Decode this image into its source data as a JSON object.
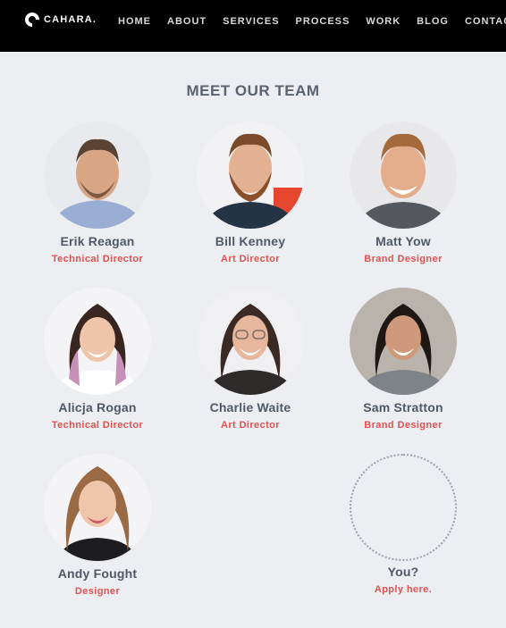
{
  "brand": {
    "name": "CAHARA."
  },
  "nav": {
    "items": [
      "HOME",
      "ABOUT",
      "SERVICES",
      "PROCESS",
      "WORK",
      "BLOG",
      "CONTACT"
    ]
  },
  "section": {
    "title": "MEET OUR TEAM"
  },
  "team": [
    {
      "name": "Erik Reagan",
      "role": "Technical Director"
    },
    {
      "name": "Bill Kenney",
      "role": "Art Director"
    },
    {
      "name": "Matt Yow",
      "role": "Brand Designer"
    },
    {
      "name": "Alicja Rogan",
      "role": "Technical Director"
    },
    {
      "name": "Charlie Waite",
      "role": "Art Director"
    },
    {
      "name": "Sam Stratton",
      "role": "Brand Designer"
    },
    {
      "name": "Andy Fought",
      "role": "Designer"
    }
  ],
  "join": {
    "title": "You?",
    "link": "Apply here."
  },
  "colors": {
    "accent": "#e0524f",
    "nav_bg": "#000000",
    "page_bg": "#eceef2"
  }
}
